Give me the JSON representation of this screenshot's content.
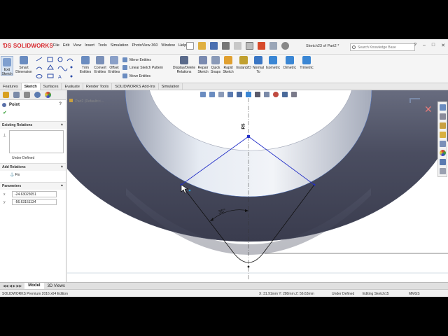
{
  "app": {
    "brand": "SOLIDWORKS",
    "menus": [
      "File",
      "Edit",
      "View",
      "Insert",
      "Tools",
      "Simulation",
      "PhotoView 360",
      "Window",
      "Help"
    ],
    "document_title": "Sketch23 of Part2 *",
    "search_placeholder": "Search Knowledge Base"
  },
  "ribbon": {
    "exit_sketch": "Exit Sketch",
    "smart_dimension": "Smart Dimension",
    "trim_entities": "Trim Entities",
    "convert_entities": "Convert Entities",
    "offset_entities": "Offset Entities",
    "mirror_entities": "Mirror Entities",
    "linear_pattern": "Linear Sketch Pattern",
    "move_entities": "Move Entities",
    "display_delete_relations": "Display/Delete Relations",
    "repair_sketch": "Repair Sketch",
    "quick_snaps": "Quick Snaps",
    "rapid_sketch": "Rapid Sketch",
    "instant2d": "Instant2D",
    "normal_to": "Normal To",
    "isometric": "Isometric",
    "dimetric": "Dimetric",
    "trimetric": "Trimetric"
  },
  "tabs": [
    "Features",
    "Sketch",
    "Surfaces",
    "Evaluate",
    "Render Tools",
    "SOLIDWORKS Add-Ins",
    "Simulation"
  ],
  "active_tab": "Sketch",
  "property_manager": {
    "title": "Point",
    "existing_relations": "Existing Relations",
    "under_defined": "Under Defined",
    "add_relations": "Add Relations",
    "fix": "Fix",
    "parameters": "Parameters",
    "x_value": "-24.63023051",
    "y_value": "-56.63151134"
  },
  "viewport": {
    "tree_label": "Part2 (Default<<..."
  },
  "sketch": {
    "radius_label": "R5",
    "angle_label": "35°"
  },
  "model_tabs": [
    "Model",
    "3D Views"
  ],
  "status": {
    "edition": "SOLIDWORKS Premium 2016 x64 Edition",
    "coords": "X: 31.91mm Y: 280mm Z: 56.63mm",
    "state": "Under Defined",
    "editing": "Editing Sketch15",
    "units": "MMGS"
  },
  "colors": {
    "accent": "#d7262b",
    "sketch_line": "#2430c8",
    "model_dark": "#3c3f52",
    "model_light": "#dde3ee"
  }
}
